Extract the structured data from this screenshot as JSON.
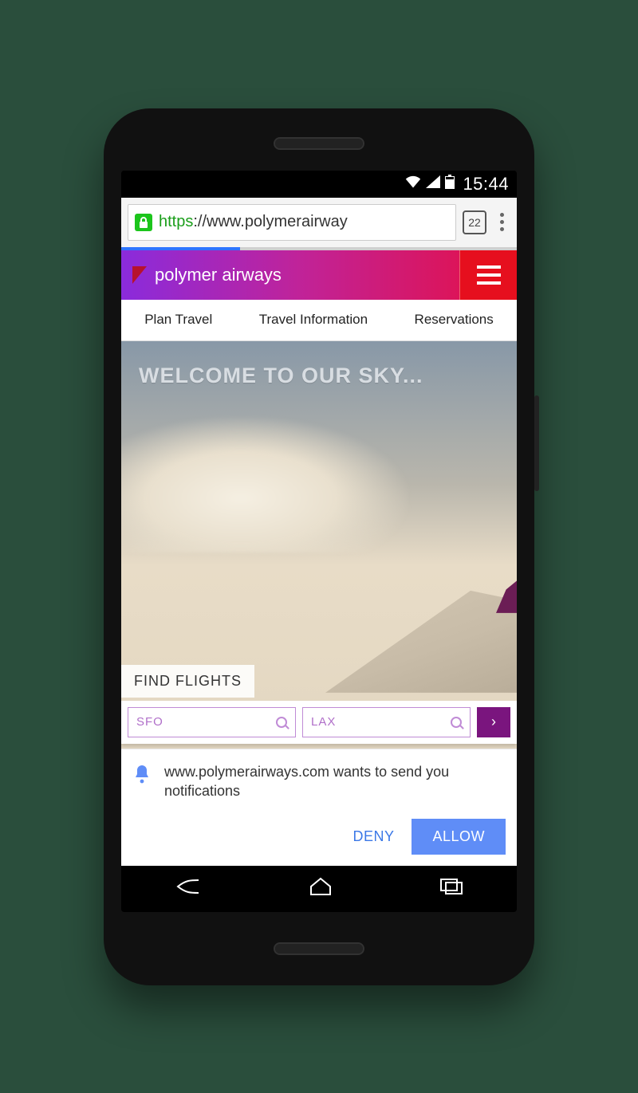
{
  "status": {
    "time": "15:44"
  },
  "chrome": {
    "scheme": "https",
    "url_display_rest": "://www.polymerairway",
    "tab_count": "22"
  },
  "header": {
    "brand": "polymer airways"
  },
  "nav": {
    "items": [
      "Plan Travel",
      "Travel Information",
      "Reservations"
    ]
  },
  "hero": {
    "headline": "WELCOME TO OUR SKY...",
    "find_label": "FIND FLIGHTS",
    "from": "SFO",
    "to": "LAX"
  },
  "prompt": {
    "text": "www.polymerairways.com wants to send you notifications",
    "deny": "DENY",
    "allow": "ALLOW"
  }
}
